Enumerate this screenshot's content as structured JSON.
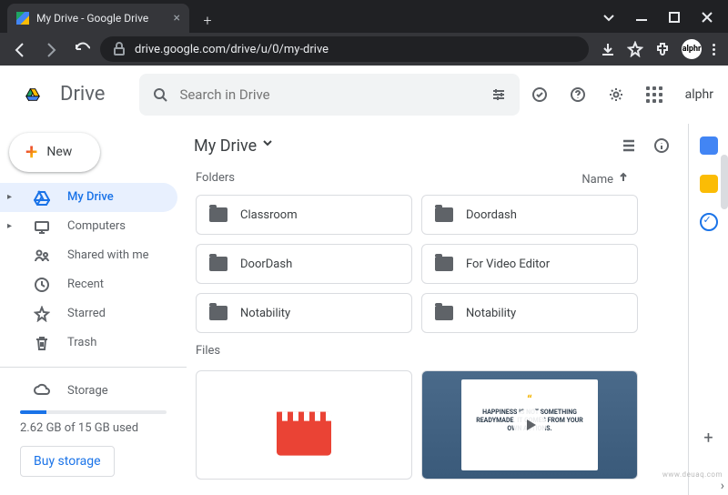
{
  "browser": {
    "tab_title": "My Drive - Google Drive",
    "url": "drive.google.com/drive/u/0/my-drive"
  },
  "header": {
    "product": "Drive",
    "search_placeholder": "Search in Drive",
    "account_label": "alphr"
  },
  "sidebar": {
    "new_label": "New",
    "items": [
      {
        "label": "My Drive",
        "icon": "drive"
      },
      {
        "label": "Computers",
        "icon": "computers"
      },
      {
        "label": "Shared with me",
        "icon": "shared"
      },
      {
        "label": "Recent",
        "icon": "recent"
      },
      {
        "label": "Starred",
        "icon": "starred"
      },
      {
        "label": "Trash",
        "icon": "trash"
      }
    ],
    "storage_label": "Storage",
    "storage_text": "2.62 GB of 15 GB used",
    "buy_label": "Buy storage"
  },
  "main": {
    "breadcrumb": "My Drive",
    "sections": {
      "folders_label": "Folders",
      "files_label": "Files",
      "sort_label": "Name"
    },
    "folders": [
      {
        "name": "Classroom"
      },
      {
        "name": "Doordash"
      },
      {
        "name": "DoorDash"
      },
      {
        "name": "For Video Editor"
      },
      {
        "name": "Notability"
      },
      {
        "name": "Notability"
      }
    ],
    "quote": "HAPPINESS IS NOT SOMETHING READYMADE. IT COMES FROM YOUR OWN ACTIONS."
  },
  "watermark": "www.deuaq.com"
}
